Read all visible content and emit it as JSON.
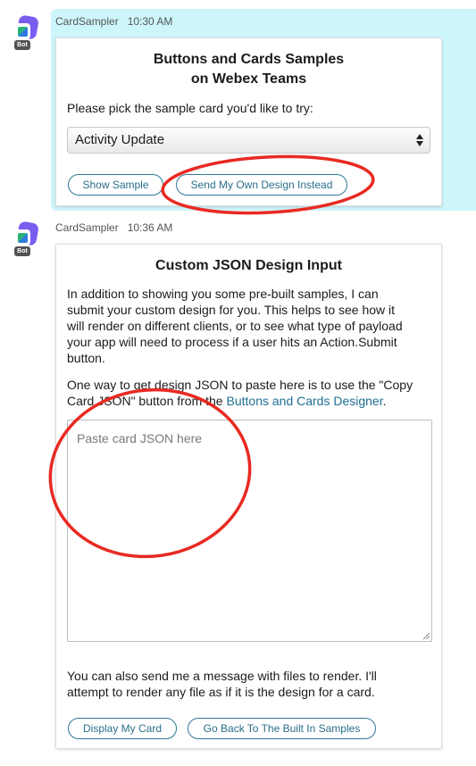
{
  "messages": [
    {
      "sender": "CardSampler",
      "time": "10:30 AM",
      "avatar_badge": "Bot",
      "card": {
        "title_line1": "Buttons and Cards Samples",
        "title_line2": "on Webex Teams",
        "prompt": "Please pick the sample card you'd like to try:",
        "select_value": "Activity Update",
        "buttons": [
          "Show Sample",
          "Send My Own Design Instead"
        ]
      }
    },
    {
      "sender": "CardSampler",
      "time": "10:36 AM",
      "avatar_badge": "Bot",
      "card": {
        "title": "Custom JSON Design Input",
        "paragraph1_lines": [
          "In addition to showing you some pre-built samples, I can",
          "submit your custom design for you.  This helps to see how it",
          "will render on different clients, or to see what type of payload",
          "your app will need to process if a user hits an Action.Submit",
          "button."
        ],
        "paragraph2_line1": "One way to get design JSON to paste here is to use the \"Copy",
        "paragraph2_line2_prefix": "Card JSON\" button from the ",
        "paragraph2_link": "Buttons and Cards Designer",
        "paragraph2_suffix": ".",
        "textarea_placeholder": "Paste card JSON here",
        "paragraph3_lines": [
          "You can also send me a message with files to render.  I'll",
          "attempt to render any file as if it is the design for a card."
        ],
        "buttons": [
          "Display My Card",
          "Go Back To The Built In Samples"
        ]
      }
    }
  ],
  "colors": {
    "highlight": "#cdf6fb",
    "button_text": "#2b6f8c",
    "link": "#1e6f93",
    "annotation": "#e82a22"
  },
  "icons": [
    "bot-avatar-icon",
    "select-arrows-icon",
    "resize-grip-icon"
  ]
}
